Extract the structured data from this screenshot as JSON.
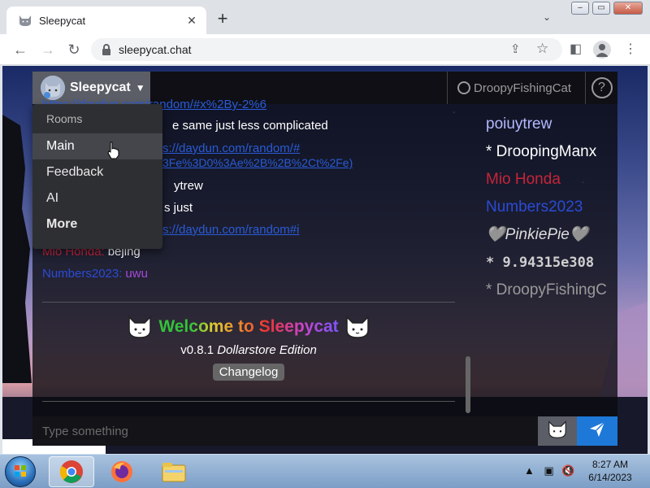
{
  "browser": {
    "tab_title": "Sleepycat",
    "new_tab_label": "+",
    "url": "sleepycat.chat"
  },
  "app": {
    "name": "Sleepycat",
    "current_user": "DroopyFishingCat",
    "help_label": "?",
    "messages": [
      {
        "author": "",
        "text": "",
        "link": "https://daydun.com/random/#x%2By-2%6",
        "author_color": "#2a5bd7"
      },
      {
        "author": "",
        "text": "e same just less complicated",
        "link": "",
        "author_color": "#fff"
      },
      {
        "author": "",
        "text": "",
        "link": "s://daydun.com/random/#",
        "author_color": "#fff"
      },
      {
        "author": "",
        "text": "",
        "link": "3Fe%3D0%3Ae%2B%2B%2Ct%2Fe)",
        "author_color": "#fff"
      },
      {
        "author": "",
        "text": "ytrew",
        "link": "",
        "author_color": "#fff"
      },
      {
        "author": "",
        "text": "s just",
        "link": "",
        "author_color": "#fff"
      },
      {
        "author": "",
        "text": "",
        "link": "s://daydun.com/random#i",
        "author_color": "#fff"
      },
      {
        "author": "Mio Honda:",
        "text": "bejing",
        "link": "",
        "author_color": "#c8243a"
      },
      {
        "author": "Numbers2023:",
        "text": "uwu",
        "link": "",
        "author_color": "#2a4bd7",
        "text_color": "#a64ad8"
      }
    ],
    "welcome": {
      "title": "Welcome to Sleepycat",
      "version": "v0.8.1",
      "edition": "Dollarstore Edition",
      "changelog_label": "Changelog"
    },
    "users": [
      {
        "name": "poiuytrew",
        "color": "#b3b8ff"
      },
      {
        "name": " * DroopingManx",
        "color": "#ffffff"
      },
      {
        "name": "Mio Honda",
        "color": "#c8243a"
      },
      {
        "name": "Numbers2023",
        "color": "#2a4bd7"
      },
      {
        "name": "🩶PinkiePie🩶",
        "color": "#dcdcdc"
      },
      {
        "name": " * 9.94315e308",
        "color": "#cfcfcf"
      },
      {
        "name": " * DroopyFishingC",
        "color": "#9a9a9a"
      }
    ],
    "input_placeholder": "Type something"
  },
  "dropdown": {
    "header": "Rooms",
    "items": [
      "Main",
      "Feedback",
      "AI",
      "More"
    ]
  },
  "taskbar": {
    "time": "8:27 AM",
    "date": "6/14/2023"
  }
}
